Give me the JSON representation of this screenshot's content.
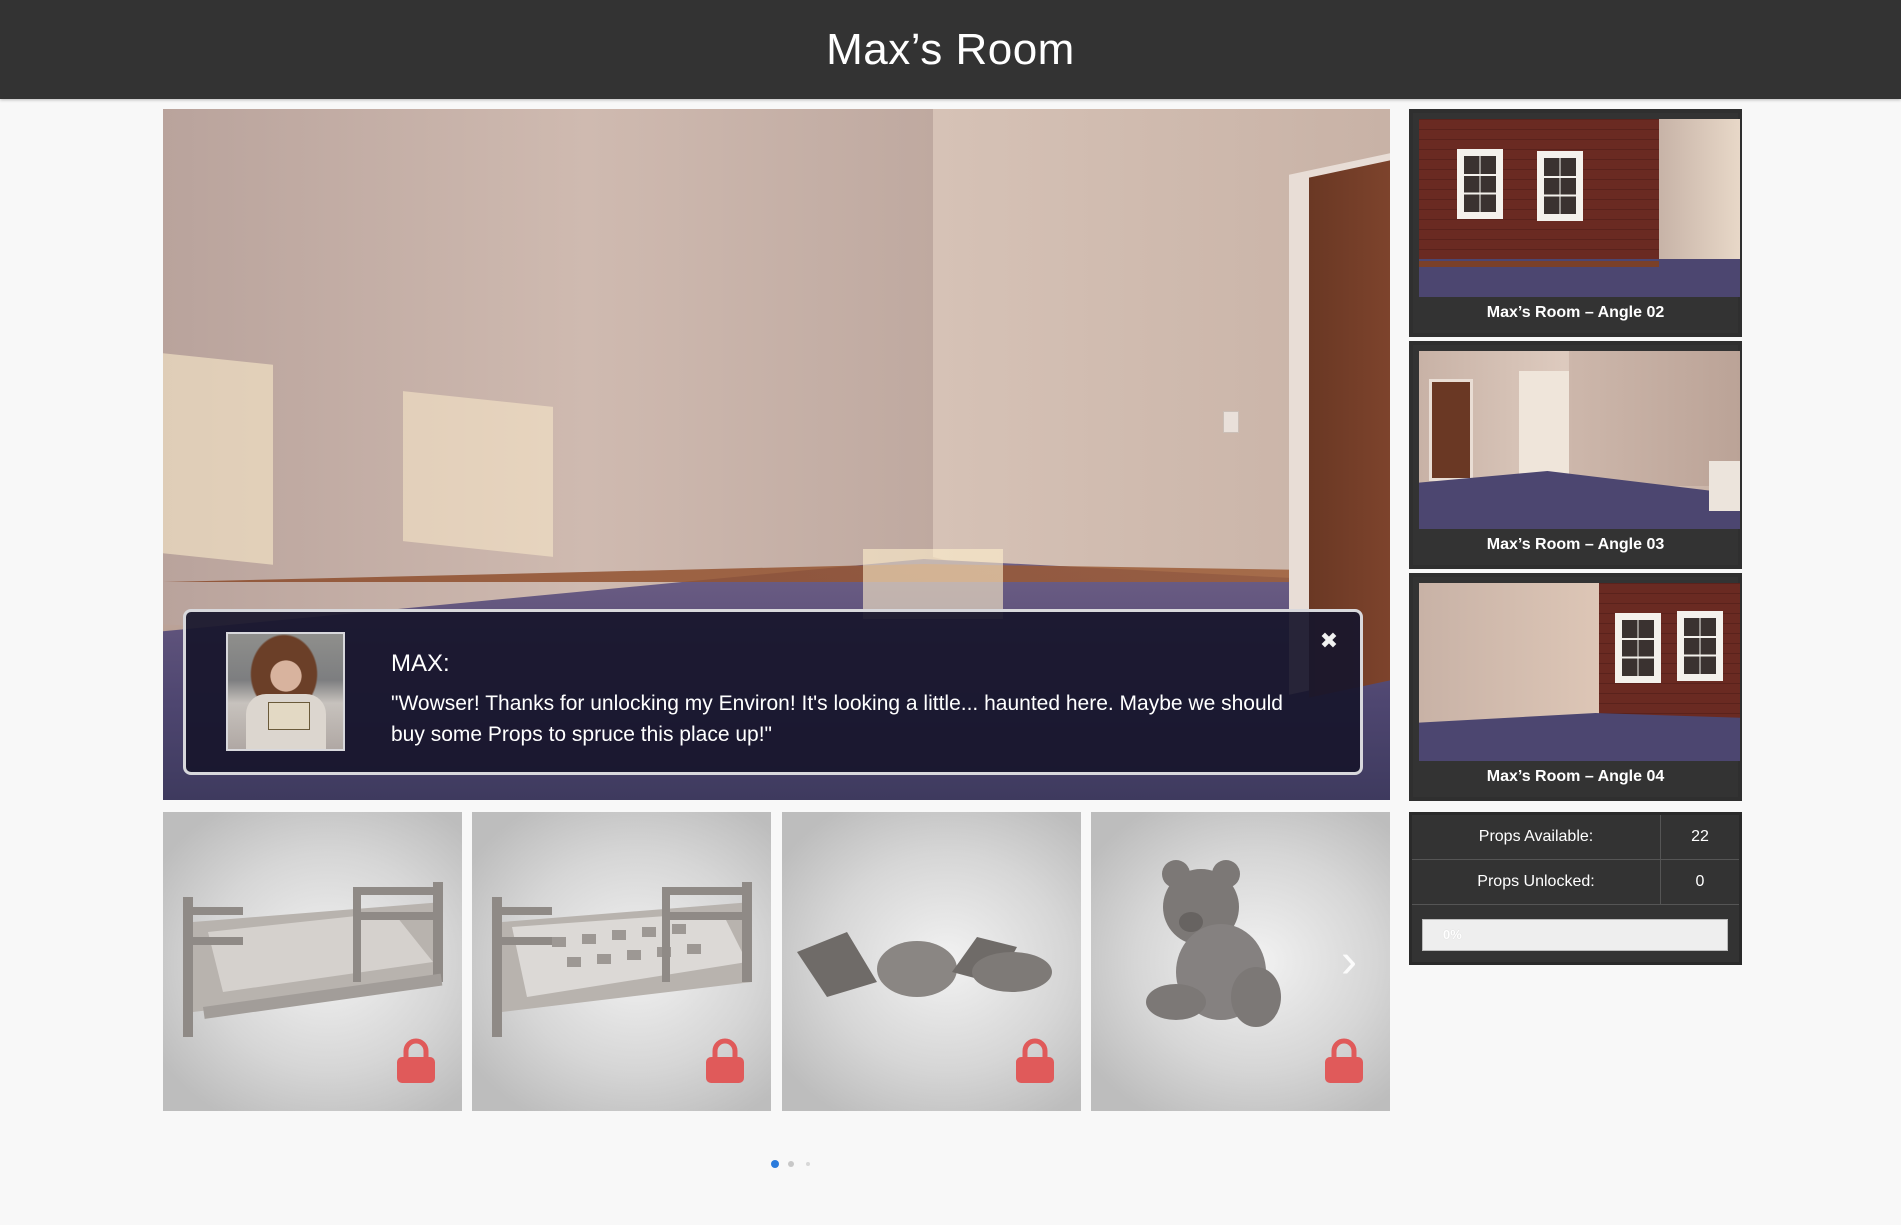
{
  "header": {
    "title": "Max’s Room"
  },
  "dialog": {
    "speaker": "MAX:",
    "message": "\"Wowser! Thanks for unlocking my Environ! It's looking a little... haunted here. Maybe we should buy some Props to spruce this place up!\"",
    "close_icon": "close-icon"
  },
  "angles": [
    {
      "label": "Max’s Room – Angle 02"
    },
    {
      "label": "Max’s Room – Angle 03"
    },
    {
      "label": "Max’s Room – Angle 04"
    }
  ],
  "stats": {
    "available_label": "Props Available:",
    "available_value": "22",
    "unlocked_label": "Props Unlocked:",
    "unlocked_value": "0",
    "progress_text": "0%",
    "progress_fraction": 0
  },
  "props": [
    {
      "name": "bed-plain",
      "locked": true
    },
    {
      "name": "bed-quilted",
      "locked": true
    },
    {
      "name": "pillows",
      "locked": true
    },
    {
      "name": "teddy-bear",
      "locked": true
    }
  ],
  "carousel": {
    "pages": 3,
    "current": 1
  },
  "colors": {
    "lock": "#e05a5a",
    "active_dot": "#2b7bdc",
    "header_bg": "#333333"
  }
}
